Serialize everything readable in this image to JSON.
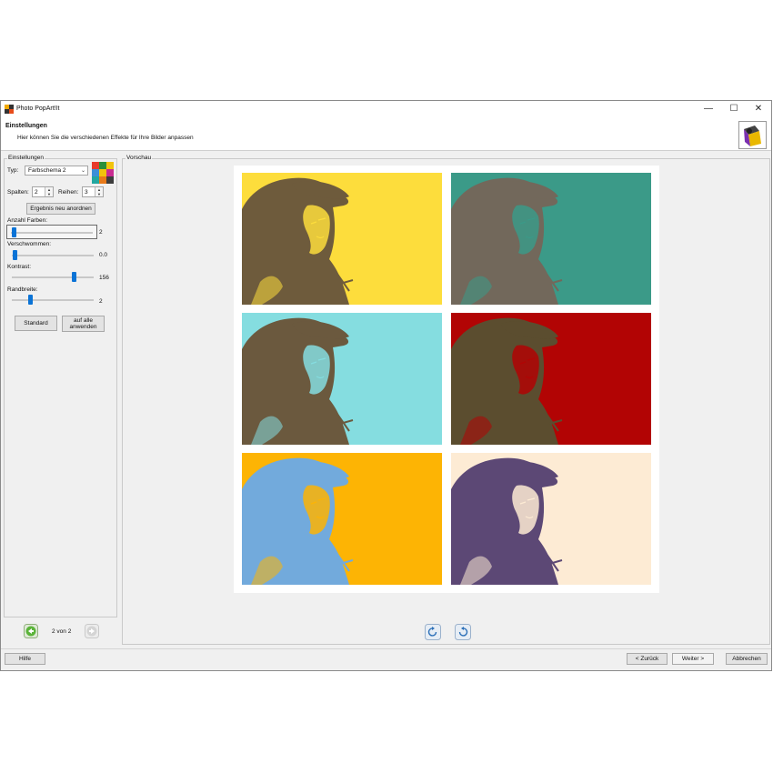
{
  "window": {
    "title": "Photo PopArt!It",
    "controls": {
      "minimize": "—",
      "maximize": "☐",
      "close": "✕"
    }
  },
  "header": {
    "title": "Einstellungen",
    "subtitle": "Hier können Sie die verschiedenen Effekte für Ihre Bilder anpassen"
  },
  "settings": {
    "group_label": "Einstellungen",
    "typ_label": "Typ:",
    "typ_value": "Farbschema 2",
    "spalten_label": "Spalten:",
    "spalten_value": "2",
    "reihen_label": "Reihen:",
    "reihen_value": "3",
    "rearrange_button": "Ergebnis neu anordnen",
    "sliders": [
      {
        "label": "Anzahl Farben:",
        "value": "2",
        "fraction": 0.0
      },
      {
        "label": "Verschwommen:",
        "value": "0.0",
        "fraction": 0.0
      },
      {
        "label": "Kontrast:",
        "value": "156",
        "fraction": 0.75
      },
      {
        "label": "Randbreite:",
        "value": "2",
        "fraction": 0.2
      }
    ],
    "standard_button": "Standard",
    "apply_all_button_line1": "auf alle",
    "apply_all_button_line2": "anwenden"
  },
  "pager": {
    "text": "2 von 2"
  },
  "preview": {
    "group_label": "Vorschau",
    "tiles": [
      {
        "bg": "#fddd3c",
        "fg": "#6e5b3c"
      },
      {
        "bg": "#3b9a88",
        "fg": "#72685b"
      },
      {
        "bg": "#85dde0",
        "fg": "#6b593e"
      },
      {
        "bg": "#b20404",
        "fg": "#5b4d2f"
      },
      {
        "bg": "#fdb404",
        "fg": "#72aadc"
      },
      {
        "bg": "#fdebd4",
        "fg": "#5c4875"
      }
    ]
  },
  "footer": {
    "help_button": "Hilfe",
    "back_button": "< Zurück",
    "next_button": "Weiter >",
    "cancel_button": "Abbrechen"
  }
}
